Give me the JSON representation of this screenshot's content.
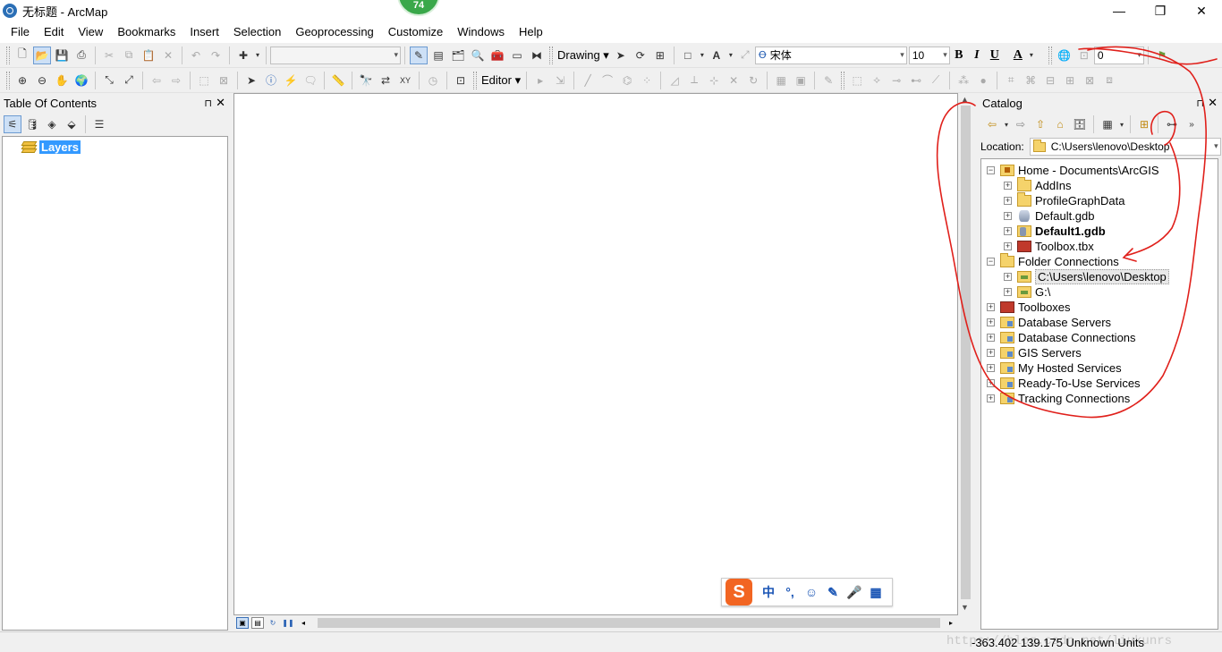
{
  "window": {
    "title": "无标题 - ArcMap",
    "badge": "74",
    "minimize": "—",
    "maximize": "❐",
    "close": "✕"
  },
  "menu": [
    "File",
    "Edit",
    "View",
    "Bookmarks",
    "Insert",
    "Selection",
    "Geoprocessing",
    "Customize",
    "Windows",
    "Help"
  ],
  "toolbar": {
    "scale_value": "",
    "drawing_label": "Drawing",
    "font_name": "宋体",
    "font_size": "10",
    "bold": "B",
    "italic": "I",
    "underline": "U",
    "font_color": "A",
    "draw_text": "A",
    "right_combo_value": "0",
    "editor_label": "Editor"
  },
  "toc": {
    "title": "Table Of Contents",
    "layers_label": "Layers",
    "pin": "⊓",
    "close": "✕"
  },
  "catalog": {
    "title": "Catalog",
    "location_label": "Location:",
    "location_value": "C:\\Users\\lenovo\\Desktop",
    "pin": "⊓",
    "close": "✕",
    "tree": {
      "home": "Home - Documents\\ArcGIS",
      "addins": "AddIns",
      "profile": "ProfileGraphData",
      "default_gdb": "Default.gdb",
      "default1_gdb": "Default1.gdb",
      "toolbox_tbx": "Toolbox.tbx",
      "folder_connections": "Folder Connections",
      "desktop": "C:\\Users\\lenovo\\Desktop",
      "g_drive": "G:\\",
      "toolboxes": "Toolboxes",
      "db_servers": "Database Servers",
      "db_connections": "Database Connections",
      "gis_servers": "GIS Servers",
      "hosted": "My Hosted Services",
      "ready": "Ready-To-Use Services",
      "tracking": "Tracking Connections"
    }
  },
  "ime": {
    "logo": "S",
    "lang": "中",
    "punct": "°,",
    "emoji": "☺",
    "pen": "✎",
    "mic": "🎤",
    "grid": "▦"
  },
  "status": {
    "coordinates": "-363.402  139.175 Unknown Units",
    "watermark": "https://blog.csdn.net/liukunrs"
  },
  "colors": {
    "selection_blue": "#3399ff",
    "annotation_red": "#e0201b",
    "badge_green": "#3aa84a"
  }
}
